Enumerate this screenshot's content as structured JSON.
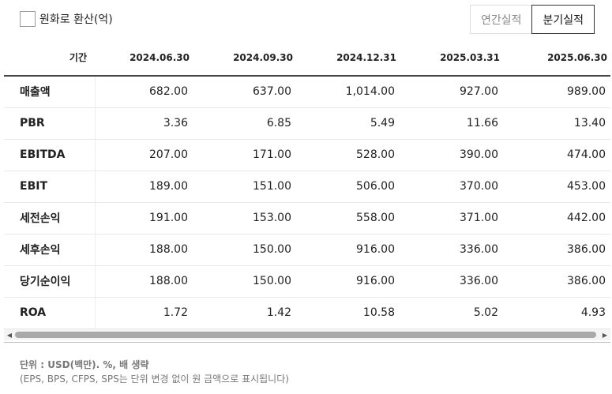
{
  "controls": {
    "convert_label": "원화로 환산(억)",
    "annual_label": "연간실적",
    "quarterly_label": "분기실적"
  },
  "table": {
    "period_header": "기간",
    "dates": [
      "2024.06.30",
      "2024.09.30",
      "2024.12.31",
      "2025.03.31",
      "2025.06.30"
    ],
    "rows": [
      {
        "label": "매출액",
        "values": [
          "682.00",
          "637.00",
          "1,014.00",
          "927.00",
          "989.00"
        ]
      },
      {
        "label": "PBR",
        "values": [
          "3.36",
          "6.85",
          "5.49",
          "11.66",
          "13.40"
        ]
      },
      {
        "label": "EBITDA",
        "values": [
          "207.00",
          "171.00",
          "528.00",
          "390.00",
          "474.00"
        ]
      },
      {
        "label": "EBIT",
        "values": [
          "189.00",
          "151.00",
          "506.00",
          "370.00",
          "453.00"
        ]
      },
      {
        "label": "세전손익",
        "values": [
          "191.00",
          "153.00",
          "558.00",
          "371.00",
          "442.00"
        ]
      },
      {
        "label": "세후손익",
        "values": [
          "188.00",
          "150.00",
          "916.00",
          "336.00",
          "386.00"
        ]
      },
      {
        "label": "당기순이익",
        "values": [
          "188.00",
          "150.00",
          "916.00",
          "336.00",
          "386.00"
        ]
      },
      {
        "label": "ROA",
        "values": [
          "1.72",
          "1.42",
          "10.58",
          "5.02",
          "4.93"
        ]
      }
    ]
  },
  "footer": {
    "unit_note": "단위 : USD(백만). %, 배 생략",
    "eps_note": "(EPS, BPS, CFPS, SPS는 단위 변경 없이 원 금액으로 표시됩니다)"
  },
  "icons": {
    "scroll_left": "triangle-left",
    "scroll_right": "triangle-right"
  }
}
